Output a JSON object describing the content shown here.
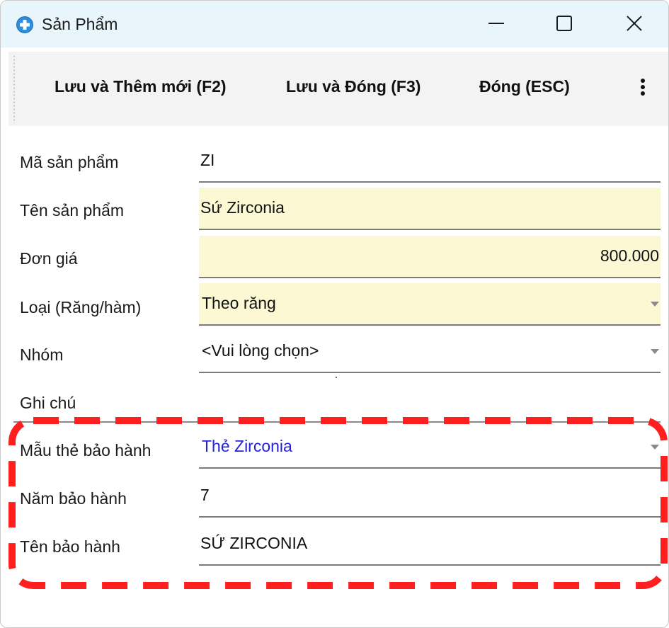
{
  "window": {
    "title": "Sản Phẩm",
    "icon": "plus-circle-icon",
    "controls": [
      "minimize-icon",
      "maximize-icon",
      "close-icon"
    ]
  },
  "toolbar": {
    "save_new_label": "Lưu và Thêm mới (F2)",
    "save_close_label": "Lưu và Đóng (F3)",
    "close_label": "Đóng (ESC)",
    "more_icon": "more-vertical-icon"
  },
  "form": {
    "product_code": {
      "label": "Mã sản phẩm",
      "value": "ZI"
    },
    "product_name": {
      "label": "Tên sản phẩm",
      "value": "Sứ Zirconia"
    },
    "unit_price": {
      "label": "Đơn giá",
      "value": "800.000"
    },
    "type": {
      "label": "Loại (Răng/hàm)",
      "value": "Theo răng"
    },
    "group": {
      "label": "Nhóm",
      "value": "<Vui lòng chọn>"
    },
    "note": {
      "label": "Ghi chú",
      "value": ""
    },
    "warranty_template": {
      "label": "Mẫu thẻ bảo hành",
      "value": "Thẻ Zirconia"
    },
    "warranty_years": {
      "label": "Năm bảo hành",
      "value": "7"
    },
    "warranty_name": {
      "label": "Tên bảo hành",
      "value": "SỨ ZIRCONIA"
    }
  },
  "colors": {
    "titlebar_bg": "#e8f6fb",
    "toolbar_bg": "#f3f3f3",
    "required_field_bg": "#fbf8d3",
    "link_blue": "#2222dd",
    "highlight_red": "#ff1f1f",
    "icon_blue": "#2b8fe0"
  }
}
